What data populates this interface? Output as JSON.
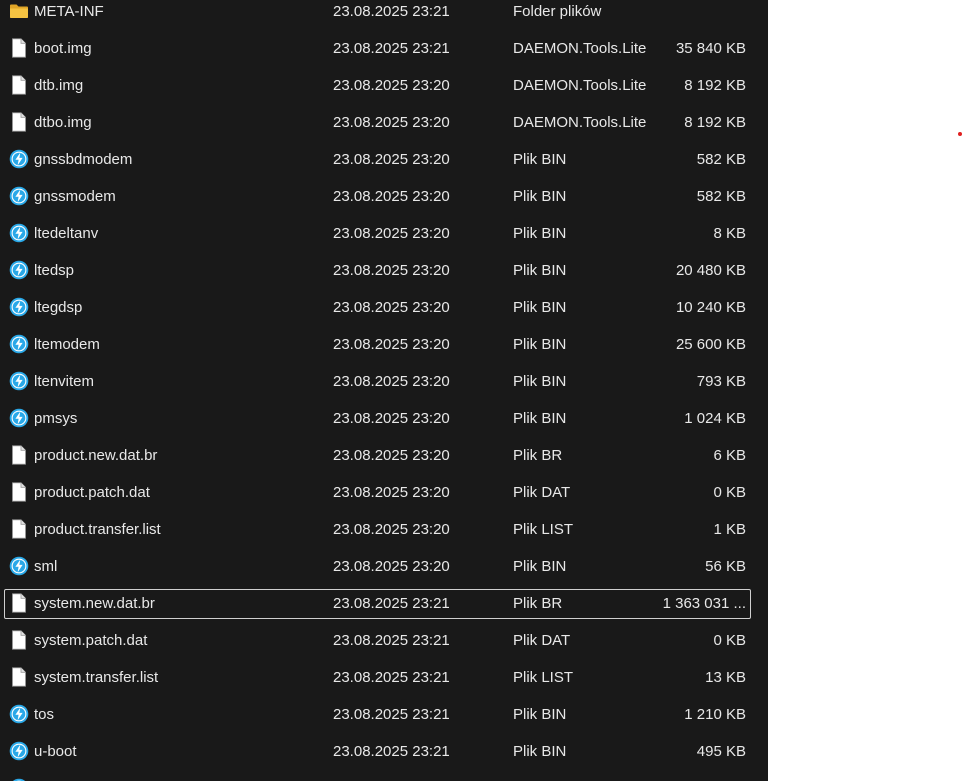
{
  "files": [
    {
      "name": "META-INF",
      "date": "23.08.2025 23:21",
      "type": "Folder plików",
      "size": "",
      "icon": "folder-icon"
    },
    {
      "name": "boot.img",
      "date": "23.08.2025 23:21",
      "type": "DAEMON.Tools.Lite",
      "size": "35 840 KB",
      "icon": "file-icon"
    },
    {
      "name": "dtb.img",
      "date": "23.08.2025 23:20",
      "type": "DAEMON.Tools.Lite",
      "size": "8 192 KB",
      "icon": "file-icon"
    },
    {
      "name": "dtbo.img",
      "date": "23.08.2025 23:20",
      "type": "DAEMON.Tools.Lite",
      "size": "8 192 KB",
      "icon": "file-icon"
    },
    {
      "name": "gnssbdmodem",
      "date": "23.08.2025 23:20",
      "type": "Plik BIN",
      "size": "582 KB",
      "icon": "daemon-tools-icon"
    },
    {
      "name": "gnssmodem",
      "date": "23.08.2025 23:20",
      "type": "Plik BIN",
      "size": "582 KB",
      "icon": "daemon-tools-icon"
    },
    {
      "name": "ltedeltanv",
      "date": "23.08.2025 23:20",
      "type": "Plik BIN",
      "size": "8 KB",
      "icon": "daemon-tools-icon"
    },
    {
      "name": "ltedsp",
      "date": "23.08.2025 23:20",
      "type": "Plik BIN",
      "size": "20 480 KB",
      "icon": "daemon-tools-icon"
    },
    {
      "name": "ltegdsp",
      "date": "23.08.2025 23:20",
      "type": "Plik BIN",
      "size": "10 240 KB",
      "icon": "daemon-tools-icon"
    },
    {
      "name": "ltemodem",
      "date": "23.08.2025 23:20",
      "type": "Plik BIN",
      "size": "25 600 KB",
      "icon": "daemon-tools-icon"
    },
    {
      "name": "ltenvitem",
      "date": "23.08.2025 23:20",
      "type": "Plik BIN",
      "size": "793 KB",
      "icon": "daemon-tools-icon"
    },
    {
      "name": "pmsys",
      "date": "23.08.2025 23:20",
      "type": "Plik BIN",
      "size": "1 024 KB",
      "icon": "daemon-tools-icon"
    },
    {
      "name": "product.new.dat.br",
      "date": "23.08.2025 23:20",
      "type": "Plik BR",
      "size": "6 KB",
      "icon": "file-icon"
    },
    {
      "name": "product.patch.dat",
      "date": "23.08.2025 23:20",
      "type": "Plik DAT",
      "size": "0 KB",
      "icon": "file-icon"
    },
    {
      "name": "product.transfer.list",
      "date": "23.08.2025 23:20",
      "type": "Plik LIST",
      "size": "1 KB",
      "icon": "file-icon"
    },
    {
      "name": "sml",
      "date": "23.08.2025 23:20",
      "type": "Plik BIN",
      "size": "56 KB",
      "icon": "daemon-tools-icon"
    },
    {
      "name": "system.new.dat.br",
      "date": "23.08.2025 23:21",
      "type": "Plik BR",
      "size": "1 363 031 ...",
      "icon": "file-icon",
      "focused": true
    },
    {
      "name": "system.patch.dat",
      "date": "23.08.2025 23:21",
      "type": "Plik DAT",
      "size": "0 KB",
      "icon": "file-icon"
    },
    {
      "name": "system.transfer.list",
      "date": "23.08.2025 23:21",
      "type": "Plik LIST",
      "size": "13 KB",
      "icon": "file-icon"
    },
    {
      "name": "tos",
      "date": "23.08.2025 23:21",
      "type": "Plik BIN",
      "size": "1 210 KB",
      "icon": "daemon-tools-icon"
    },
    {
      "name": "u-boot",
      "date": "23.08.2025 23:21",
      "type": "Plik BIN",
      "size": "495 KB",
      "icon": "daemon-tools-icon"
    },
    {
      "name": "",
      "date": "",
      "type": "",
      "size": "",
      "icon": "daemon-tools-icon"
    }
  ],
  "colors": {
    "background": "#191919",
    "text": "#e8e8e8",
    "folder": "#f5c342",
    "daemon_blue": "#29a8e8",
    "focus_border": "#d0d0d0",
    "outside_background": "#ffffff",
    "marker_red": "#e02020"
  }
}
